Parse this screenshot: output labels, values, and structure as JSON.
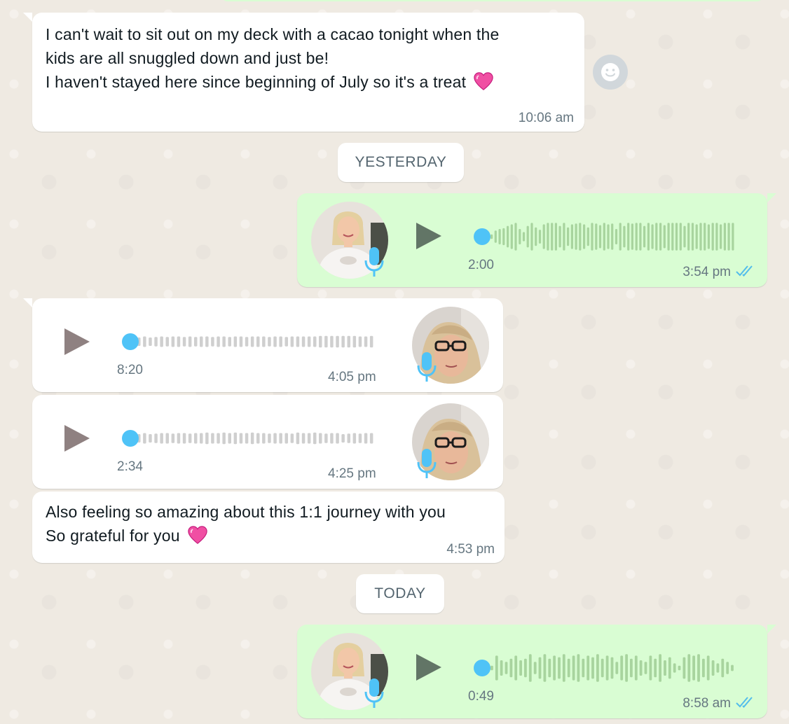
{
  "colors": {
    "background": "#efeae2",
    "incoming_bubble": "#ffffff",
    "outgoing_bubble": "#d9fdd3",
    "read_ticks": "#53bdeb",
    "progress_dot": "#4fc3f7",
    "mic": "#4fc3f7"
  },
  "messages": [
    {
      "type": "text",
      "direction": "incoming",
      "lines": [
        "I can't wait to sit out on my deck with a cacao tonight when the",
        "kids are all snuggled down and just be!",
        "I haven't stayed here since beginning of July so it's a treat"
      ],
      "emoji": "heart-emoji",
      "time": "10:06 am"
    },
    {
      "type": "date",
      "label": "YESTERDAY"
    },
    {
      "type": "voice",
      "direction": "outgoing",
      "duration": "2:00",
      "time": "3:54 pm",
      "status": "read",
      "progress": 0
    },
    {
      "type": "voice",
      "direction": "incoming",
      "duration": "8:20",
      "time": "4:05 pm",
      "progress": 0
    },
    {
      "type": "voice",
      "direction": "incoming",
      "duration": "2:34",
      "time": "4:25 pm",
      "progress": 0
    },
    {
      "type": "text",
      "direction": "incoming",
      "lines": [
        "Also feeling so amazing about this 1:1 journey with you",
        "So grateful for you"
      ],
      "emoji": "heart-emoji",
      "time": "4:53 pm"
    },
    {
      "type": "date",
      "label": "TODAY"
    },
    {
      "type": "voice",
      "direction": "outgoing",
      "duration": "0:49",
      "time": "8:58 am",
      "status": "read",
      "progress": 0
    }
  ],
  "icons": {
    "emoji_button": "smiley-icon",
    "play": "play-icon",
    "mic": "microphone-icon",
    "read_receipt": "double-check-icon"
  }
}
